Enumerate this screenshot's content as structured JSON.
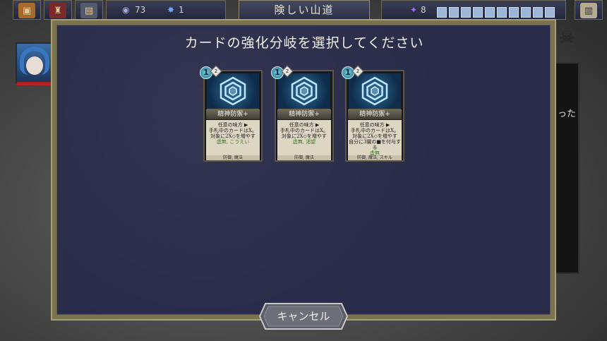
{
  "hud": {
    "gold_count": "73",
    "crystal_count": "1",
    "location_title": "険しい山道",
    "deck_count": "8",
    "slots": 10
  },
  "side": {
    "right_text": "った"
  },
  "modal": {
    "title": "カードの強化分岐を選択してください",
    "cancel_label": "キャンセル"
  },
  "cards": [
    {
      "cost": "1",
      "rarity": "2",
      "name": "精神防禦+",
      "lines": [
        "任意の味方 ▶",
        "手札中のカードはX。",
        "対象に2X◇を増やす"
      ],
      "keywords": "虚無, こうえい",
      "tags": "防御, 魔法"
    },
    {
      "cost": "1",
      "rarity": "2",
      "name": "精神防禦+",
      "lines": [
        "任意の味方 ▶",
        "手札中のカードはX。",
        "対象に2X◇を増やす"
      ],
      "keywords": "虚無, 渇望",
      "tags": "防御, 魔法"
    },
    {
      "cost": "1",
      "rarity": "2",
      "name": "精神防禦+",
      "lines": [
        "任意の味方 ▶",
        "手札中のカードはX。",
        "対象に2X◇を増やす",
        "自分に3層の■を付与する"
      ],
      "keywords": "虚無",
      "tags": "防御, 魔法, スキル"
    }
  ],
  "colors": {
    "modal_bg": "#2a2d4a",
    "frame": "#7a7250",
    "highlight": "#b68a10"
  }
}
